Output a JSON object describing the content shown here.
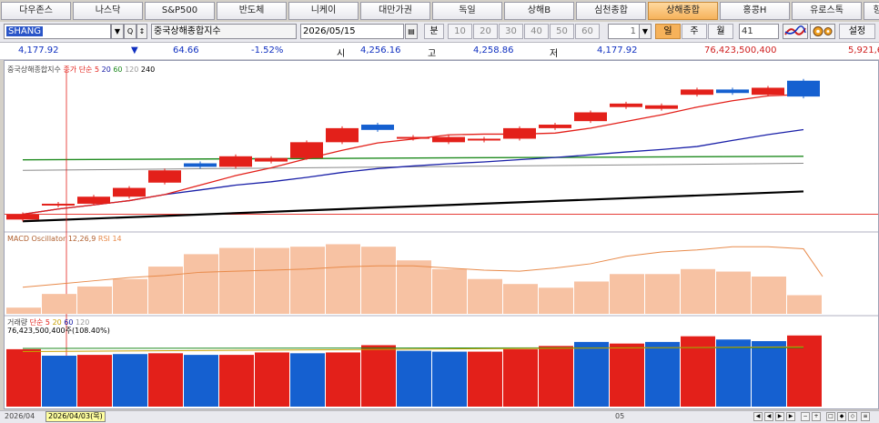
{
  "tabs": [
    {
      "label": "다우존스",
      "active": false
    },
    {
      "label": "나스닥",
      "active": false
    },
    {
      "label": "S&P500",
      "active": false
    },
    {
      "label": "반도체",
      "active": false
    },
    {
      "label": "니케이",
      "active": false
    },
    {
      "label": "대만가권",
      "active": false
    },
    {
      "label": "독일",
      "active": false
    },
    {
      "label": "상해B",
      "active": false
    },
    {
      "label": "심천종합",
      "active": false
    },
    {
      "label": "상해종합",
      "active": true
    },
    {
      "label": "홍콩H",
      "active": false
    },
    {
      "label": "유로스톡",
      "active": false
    },
    {
      "label": "항...",
      "active": false
    }
  ],
  "controls": {
    "code": "SHANG",
    "name": "중국상해종합지수",
    "date": "2026/05/15",
    "minute_label": "분",
    "minute_options": [
      "10",
      "20",
      "30",
      "40",
      "50",
      "60"
    ],
    "count": "1",
    "period": [
      {
        "label": "일",
        "on": true
      },
      {
        "label": "주",
        "on": false
      },
      {
        "label": "월",
        "on": false
      }
    ],
    "period_count": "41",
    "settings_label": "설정"
  },
  "quote": {
    "close": "4,177.92",
    "change_arrow": "▼",
    "change": "64.66",
    "change_pct": "-1.52%",
    "open_label": "시",
    "open": "4,256.16",
    "high_label": "고",
    "high": "4,258.86",
    "low_label": "저",
    "low": "4,177.92",
    "volume": "76,423,500,400",
    "extra": "5,921,6"
  },
  "price_legend": {
    "title": "중국상해종합지수",
    "ma_label": "종가 단순",
    "ma": [
      "5",
      "20",
      "60",
      "120",
      "240"
    ]
  },
  "macd_legend": {
    "label": "MACD Oscillator 12,26,9",
    "rsi": "RSI 14"
  },
  "vol_legend": {
    "label": "거래량",
    "ma_label": "단순",
    "ma": [
      "5",
      "20",
      "60",
      "120"
    ],
    "value": "76,423,500,400주(108.40%)"
  },
  "x_axis": {
    "start": "2026/04",
    "mid": "05",
    "cursor": "2026/04/03(목)"
  },
  "colors": {
    "up": "#e3201a",
    "down": "#1560d0",
    "ma5": "#e3201a",
    "ma20": "#1a20a8",
    "ma60": "#1e8a1e",
    "ma120": "#8a8a8a",
    "ma240": "#000000",
    "osc": "#f7c2a3",
    "rsi": "#e88a4a"
  },
  "chart_data": {
    "type": "candlestick",
    "candles": [
      {
        "o": 4177,
        "c": 4180
      },
      {
        "o": 4186,
        "c": 4186
      },
      {
        "o": 4186,
        "c": 4190
      },
      {
        "o": 4190,
        "c": 4195
      },
      {
        "o": 4198,
        "c": 4205
      },
      {
        "o": 4209,
        "c": 4207
      },
      {
        "o": 4207,
        "c": 4213
      },
      {
        "o": 4210,
        "c": 4212
      },
      {
        "o": 4212,
        "c": 4221
      },
      {
        "o": 4221,
        "c": 4229
      },
      {
        "o": 4231,
        "c": 4228
      },
      {
        "o": 4224,
        "c": 4224
      },
      {
        "o": 4221,
        "c": 4224
      },
      {
        "o": 4223,
        "c": 4223
      },
      {
        "o": 4223,
        "c": 4229
      },
      {
        "o": 4229,
        "c": 4231
      },
      {
        "o": 4233,
        "c": 4238
      },
      {
        "o": 4241,
        "c": 4243
      },
      {
        "o": 4240,
        "c": 4242
      },
      {
        "o": 4248,
        "c": 4251
      },
      {
        "o": 4251,
        "c": 4249
      },
      {
        "o": 4248,
        "c": 4252
      },
      {
        "o": 4256,
        "c": 4247
      }
    ],
    "osc": [
      5,
      16,
      22,
      28,
      38,
      48,
      53,
      53,
      54,
      56,
      54,
      43,
      36,
      28,
      24,
      21,
      26,
      32,
      32,
      36,
      34,
      30,
      15
    ],
    "rsi": [
      25,
      28,
      31,
      34,
      36,
      39,
      40,
      41,
      42,
      44,
      45,
      45,
      43,
      41,
      40,
      43,
      47,
      54,
      58,
      60,
      63,
      63,
      61,
      35
    ],
    "volume": [
      {
        "v": 91,
        "up": true
      },
      {
        "v": 83,
        "up": false
      },
      {
        "v": 84,
        "up": true
      },
      {
        "v": 85,
        "up": false
      },
      {
        "v": 86,
        "up": true
      },
      {
        "v": 84,
        "up": false
      },
      {
        "v": 84,
        "up": true
      },
      {
        "v": 87,
        "up": true
      },
      {
        "v": 86,
        "up": false
      },
      {
        "v": 87,
        "up": true
      },
      {
        "v": 96,
        "up": true
      },
      {
        "v": 89,
        "up": false
      },
      {
        "v": 88,
        "up": false
      },
      {
        "v": 88,
        "up": true
      },
      {
        "v": 91,
        "up": true
      },
      {
        "v": 95,
        "up": true
      },
      {
        "v": 100,
        "up": false
      },
      {
        "v": 98,
        "up": true
      },
      {
        "v": 100,
        "up": false
      },
      {
        "v": 107,
        "up": true
      },
      {
        "v": 103,
        "up": false
      },
      {
        "v": 101,
        "up": false
      },
      {
        "v": 108,
        "up": true
      }
    ]
  }
}
